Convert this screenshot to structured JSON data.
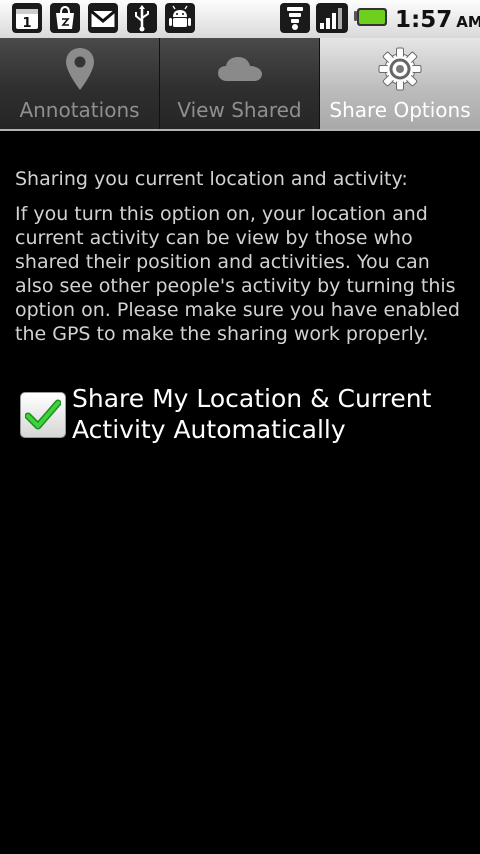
{
  "status_bar": {
    "icons": [
      "calendar-icon",
      "market-icon",
      "gmail-icon",
      "usb-icon",
      "android-debug-icon",
      "wifi-icon",
      "signal-icon",
      "battery-icon"
    ],
    "time": "1:57",
    "ampm": "AM"
  },
  "tabs": [
    {
      "label": "Annotations",
      "icon": "map-pin-icon",
      "selected": false
    },
    {
      "label": "View Shared",
      "icon": "cloud-icon",
      "selected": false
    },
    {
      "label": "Share Options",
      "icon": "gear-icon",
      "selected": true
    }
  ],
  "content": {
    "heading": "Sharing you current location and activity:",
    "description": "If you turn this option on, your location and current activity can be view by those who shared their position and activities. You can also see other people's activity by turning this option on. Please make sure you have enabled the GPS to make the sharing work properly.",
    "checkbox": {
      "label": "Share My Location & Current Activity Automatically",
      "checked": true
    }
  },
  "colors": {
    "background": "#000000",
    "text": "#d2d2d2",
    "checkmark": "#2bb52b",
    "battery": "#6fcf1f"
  }
}
